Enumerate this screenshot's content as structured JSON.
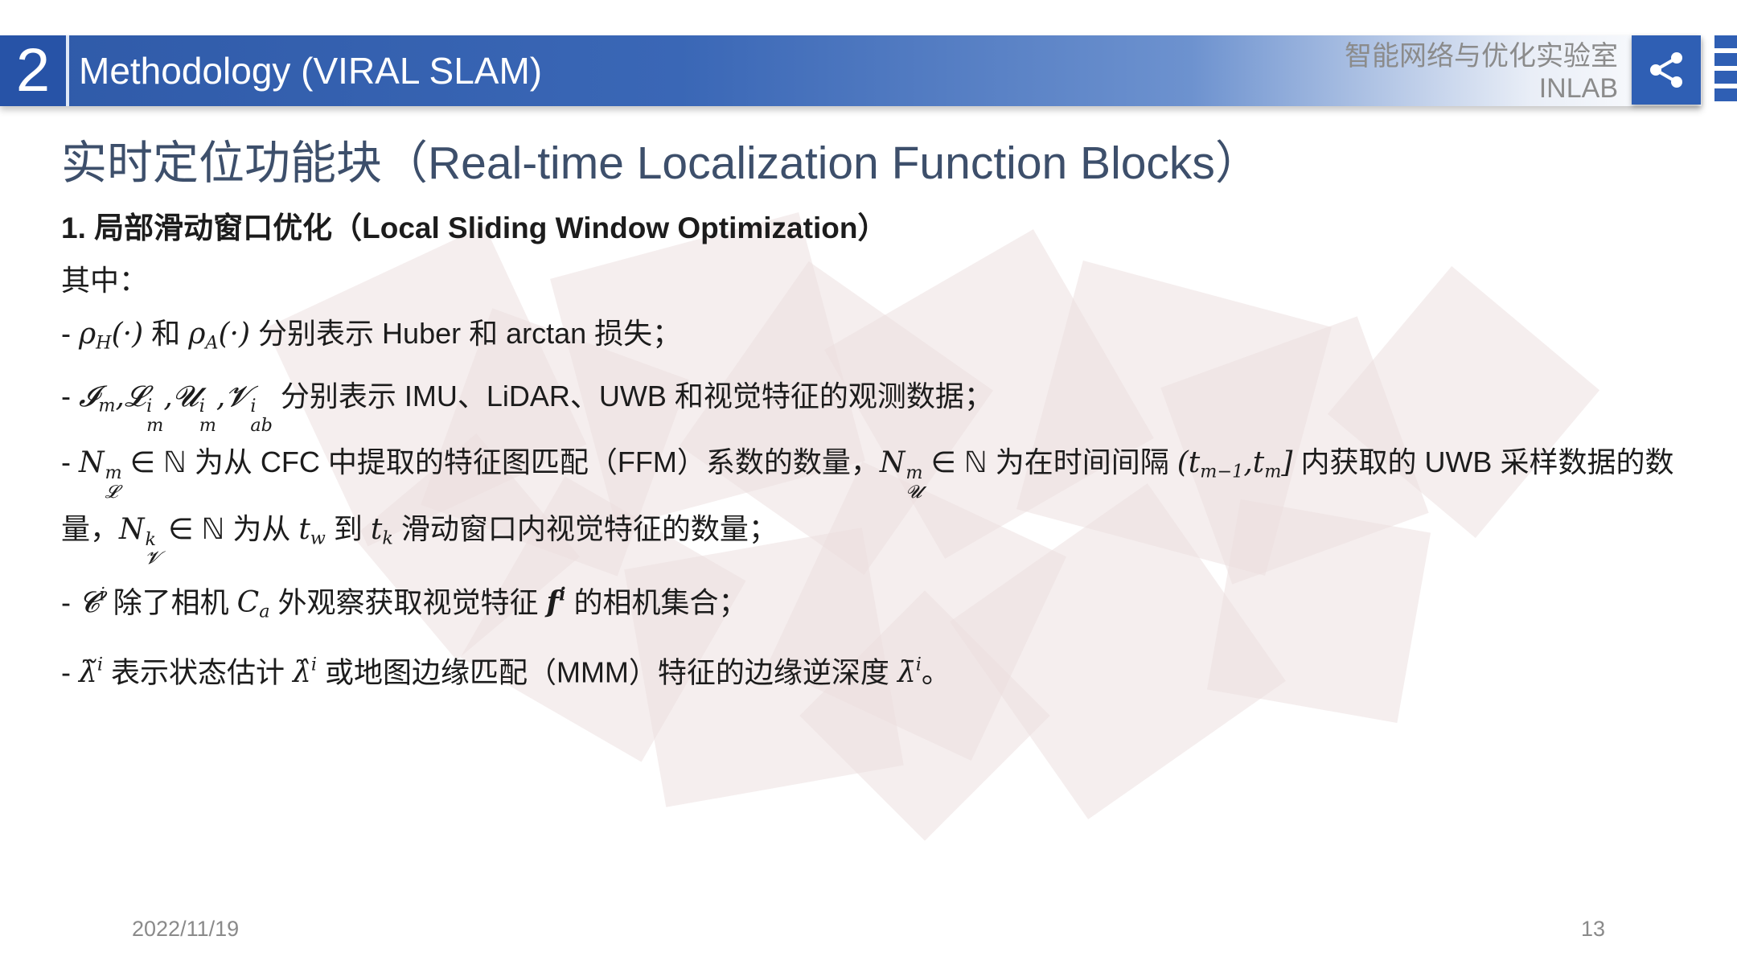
{
  "header": {
    "section_number": "2",
    "title": "Methodology (VIRAL SLAM)",
    "lab_name_cn": "智能网络与优化实验室",
    "lab_name_en": "INLAB",
    "share_icon": "share-icon",
    "colors": {
      "bar": "#3a67b6",
      "accent": "#2f5fb4"
    }
  },
  "slide": {
    "title": "实时定位功能块（Real-time Localization Function Blocks）",
    "heading": "1. 局部滑动窗口优化（Local Sliding Window Optimization）",
    "intro": "其中：",
    "items": {
      "rho": {
        "dash": "- ",
        "rho": "ρ",
        "sub_h": "H",
        "paren1": "(·)",
        "and": " 和 ",
        "sub_a": "A",
        "paren2": "(·)",
        "text": " 分别表示 Huber 和 arctan 损失；"
      },
      "obs": {
        "dash": "- ",
        "i_sym": "𝓘",
        "m": "m",
        "comma": ",",
        "l_sym": "𝓛",
        "u_sym": "𝓤",
        "v_sym": "𝓥",
        "i": "i",
        "ab": "ab",
        "text": " 分别表示 IMU、LiDAR、UWB 和视觉特征的观测数据；"
      },
      "counts": {
        "dash": "- ",
        "n": "N",
        "m": "m",
        "k": "k",
        "l_sub": "𝓛",
        "u_sub": "𝓤",
        "v_sub": "𝓥",
        "in_nat": " ∈ ℕ ",
        "t1": "为从 CFC 中提取的特征图匹配（FFM）系数的数量，",
        "t2": "为在时间间隔 ",
        "interval_open": "(",
        "t": "t",
        "sub_m1": "m−1",
        "sub_m": "m",
        "interval_close": "]",
        "t3": " 内获取的 UWB 采样数据的数量，",
        "t4": "为从 ",
        "sub_w": "w",
        "t5": " 到 ",
        "sub_k": "k",
        "t6": " 滑动窗口内视觉特征的数量；"
      },
      "cam": {
        "dash": "- ",
        "c_sym": "𝓒",
        "i": "i",
        "t1": " 除了相机 ",
        "c_plain": "C",
        "sub_a": "a",
        "t2": " 外观察获取视觉特征 ",
        "f": "f",
        "t3": " 的相机集合；"
      },
      "lambda": {
        "dash": "- ",
        "tilde": "λ̃",
        "hat": "λ̂",
        "bar": "λ̄",
        "i": "i",
        "t1": " 表示状态估计 ",
        "t2": " 或地图边缘匹配（MMM）特征的边缘逆深度 ",
        "t3": "。"
      }
    }
  },
  "footer": {
    "date": "2022/11/19",
    "page": "13"
  }
}
